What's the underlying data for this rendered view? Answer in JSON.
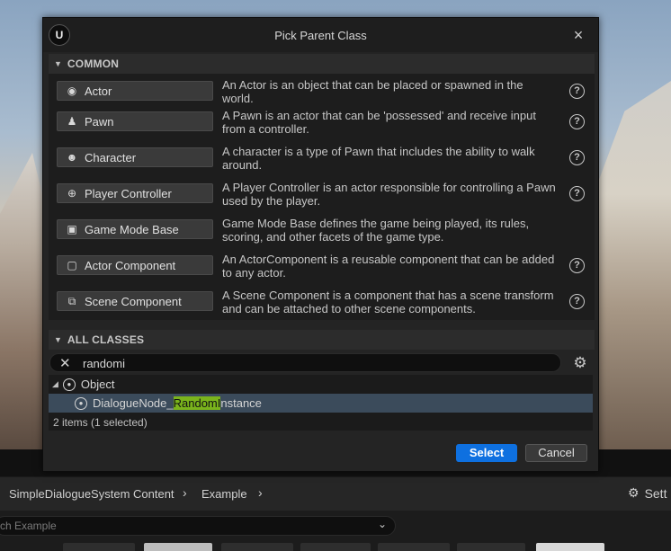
{
  "dialog": {
    "title": "Pick Parent Class",
    "logo_text": "U",
    "close_icon": "×"
  },
  "common": {
    "header": "COMMON",
    "items": [
      {
        "label": "Actor",
        "icon": "actor-icon",
        "glyph": "◉",
        "desc": "An Actor is an object that can be placed or spawned in the world.",
        "help": true
      },
      {
        "label": "Pawn",
        "icon": "pawn-icon",
        "glyph": "♟",
        "desc": "A Pawn is an actor that can be 'possessed' and receive input from a controller.",
        "help": true
      },
      {
        "label": "Character",
        "icon": "character-icon",
        "glyph": "☻",
        "desc": "A character is a type of Pawn that includes the ability to walk around.",
        "help": true
      },
      {
        "label": "Player Controller",
        "icon": "gamepad-icon",
        "glyph": "⊕",
        "desc": "A Player Controller is an actor responsible for controlling a Pawn used by the player.",
        "help": true
      },
      {
        "label": "Game Mode Base",
        "icon": "image-icon",
        "glyph": "▣",
        "desc": "Game Mode Base defines the game being played, its rules, scoring, and other facets of the game type.",
        "help": false
      },
      {
        "label": "Actor Component",
        "icon": "component-icon",
        "glyph": "▢",
        "desc": "An ActorComponent is a reusable component that can be added to any actor.",
        "help": true
      },
      {
        "label": "Scene Component",
        "icon": "scene-component-icon",
        "glyph": "⧉",
        "desc": "A Scene Component is a component that has a scene transform and can be attached to other scene components.",
        "help": true
      }
    ],
    "help_glyph": "?"
  },
  "all_classes": {
    "header": "ALL CLASSES",
    "filter_value": "randomi",
    "tree": {
      "root": "Object",
      "child_prefix": "DialogueNode_",
      "child_match": "RandomI",
      "child_suffix": "nstance"
    },
    "count": "2 items (1 selected)"
  },
  "buttons": {
    "select": "Select",
    "cancel": "Cancel"
  },
  "background": {
    "breadcrumb": [
      "SimpleDialogueSystem Content",
      "Example"
    ],
    "settings_label": "Sett",
    "search_text": "ch Example"
  },
  "colors": {
    "accent": "#0e70e0",
    "selection": "#3b4b5b",
    "highlight": "#7ab31c"
  }
}
